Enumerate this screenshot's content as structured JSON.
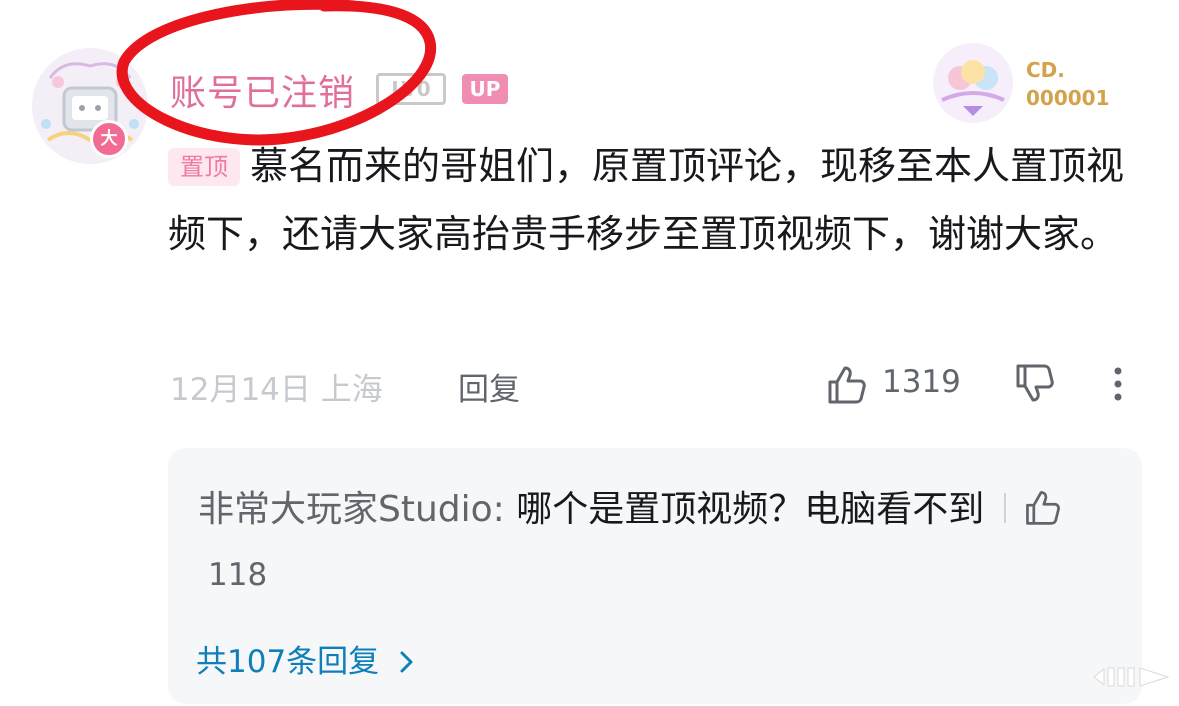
{
  "comment": {
    "username": "账号已注销",
    "level_badge": "LV0",
    "up_badge": "UP",
    "avatar_badge": "大",
    "medal_text_line1": "CD.",
    "medal_text_line2": "000001",
    "pin_label": "置顶",
    "text": "慕名而来的哥姐们，原置顶评论，现移至本人置顶视频下，还请大家高抬贵手移步至置顶视频下，谢谢大家。",
    "date_location": "12月14日 上海",
    "reply_label": "回复",
    "like_count": "1319",
    "icons": {
      "like": "thumbs-up-icon",
      "dislike": "thumbs-down-icon",
      "more": "more-vertical-icon"
    }
  },
  "reply_preview": {
    "username": "非常大玩家Studio:",
    "text": " 哪个是置顶视频？电脑看不到",
    "like_count": "118",
    "view_all": "共107条回复"
  },
  "colors": {
    "username_pink": "#e06f9d",
    "annotation_red": "#e8161c",
    "link_blue": "#0e7fb8"
  }
}
